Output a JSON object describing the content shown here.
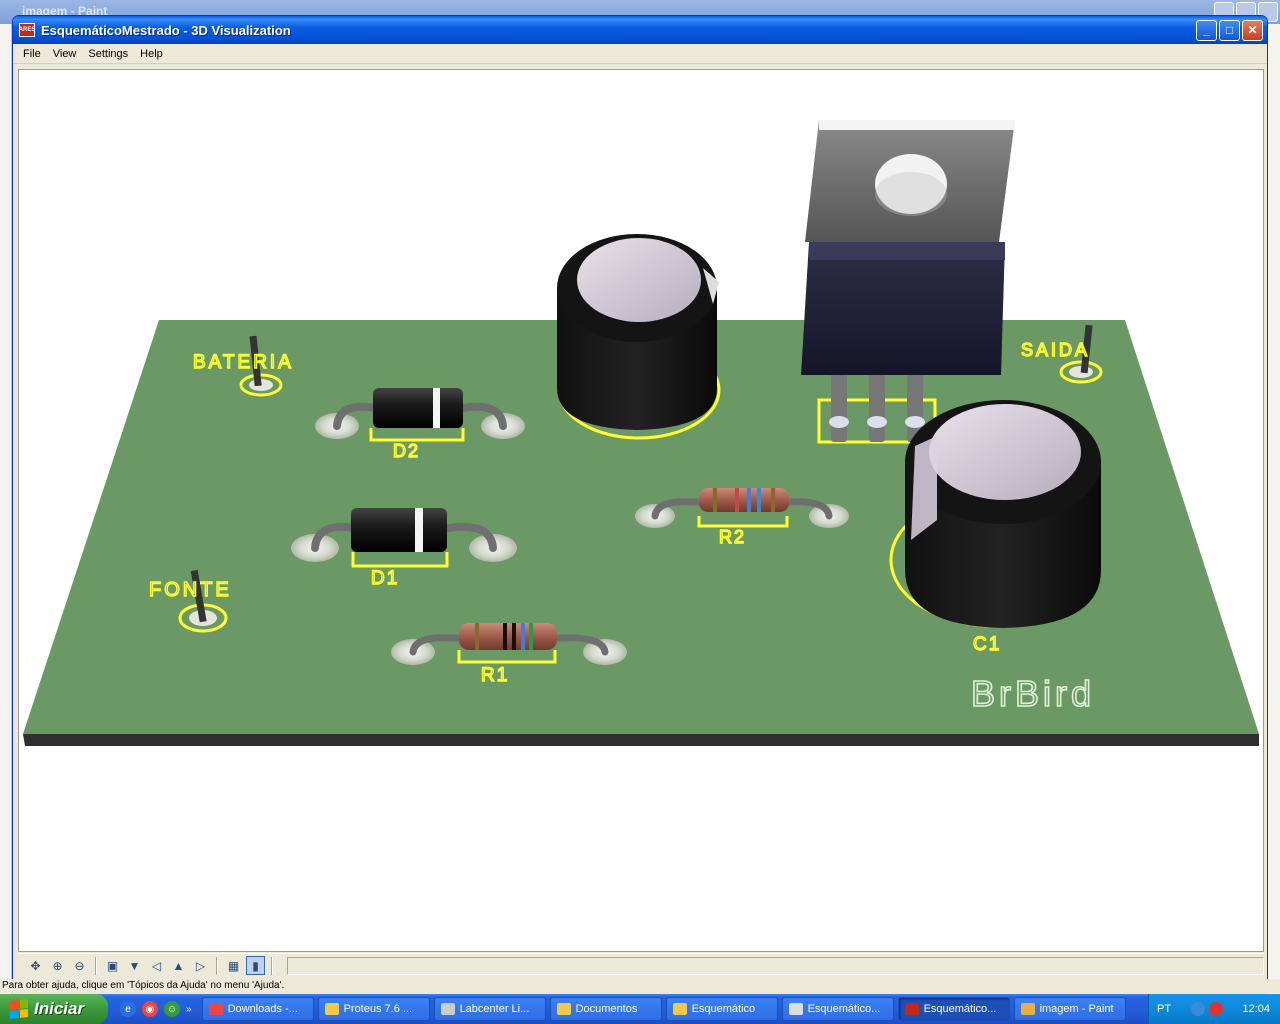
{
  "background_app": {
    "title": "imagem - Paint"
  },
  "window": {
    "title": "EsquemáticoMestrado - 3D Visualization",
    "app_icon_text": "ARES",
    "minimize": "_",
    "maximize": "□",
    "close": "✕"
  },
  "menu": [
    "File",
    "View",
    "Settings",
    "Help"
  ],
  "board": {
    "silkscreen": [
      "BATERIA",
      "SAIDA",
      "FONTE",
      "D2",
      "D1",
      "R1",
      "R2",
      "C1"
    ],
    "logo": "BrBird",
    "colors": {
      "pcb": "#6b9966",
      "silkscreen": "#ffff33",
      "edge": "#2f2f2f"
    }
  },
  "toolbar": {
    "icons": [
      "pan-icon",
      "zoom-in-icon",
      "zoom-out-icon",
      "view-top-icon",
      "view-front-icon",
      "view-left-icon",
      "view-back-icon",
      "view-right-icon",
      "grid-icon",
      "board-icon"
    ]
  },
  "statusline": "Para obter ajuda, clique em 'Tópicos da Ajuda' no menu 'Ajuda'.",
  "taskbar": {
    "start": "Iniciar",
    "tasks": [
      "Downloads -...",
      "Proteus 7.6 ...",
      "Labcenter Li...",
      "Documentos",
      "Esquemático",
      "Esquemático...",
      "Esquemático...",
      "imagem - Paint"
    ],
    "active_task": 6,
    "lang": "PT",
    "clock": "12:04"
  }
}
